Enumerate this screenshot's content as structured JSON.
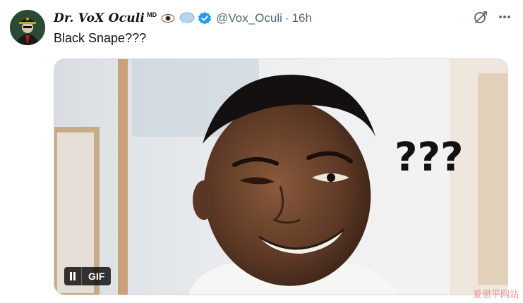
{
  "author": {
    "display_name": "Dr. VoX Oculi",
    "name_suffix": "MD",
    "handle": "@Vox_Oculi",
    "separator": "·",
    "time": "16h",
    "avatar_icon": "avatar-officer-icon",
    "emoji_icons": [
      "eye-icon",
      "speech-bubble-icon"
    ],
    "verified_color": "#1d9bf0"
  },
  "tweet": {
    "text": "Black Snape???"
  },
  "media": {
    "type": "gif",
    "gif_label": "GIF",
    "overlay_text": "???",
    "pause_icon": "pause-icon"
  },
  "actions": {
    "grok_icon": "grok-icon",
    "more_icon": "more-icon"
  },
  "watermark": "爱思平网站"
}
